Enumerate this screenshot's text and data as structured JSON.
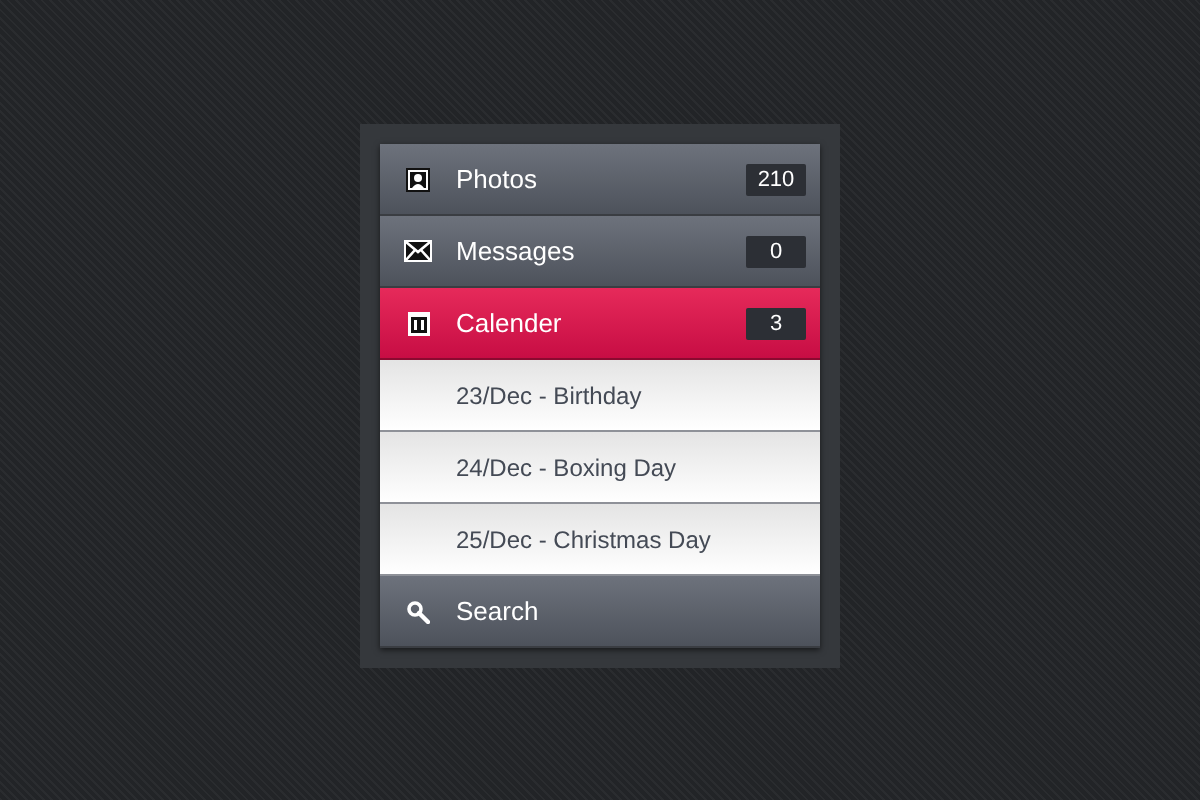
{
  "menu": [
    {
      "kind": "photos",
      "label": "Photos",
      "count": "210",
      "selected": false
    },
    {
      "kind": "messages",
      "label": "Messages",
      "count": "0",
      "selected": false
    },
    {
      "kind": "calendar",
      "label": "Calender",
      "count": "3",
      "selected": true,
      "expanded": true,
      "children": [
        {
          "label": "23/Dec - Birthday"
        },
        {
          "label": "24/Dec - Boxing Day"
        },
        {
          "label": "25/Dec - Christmas Day"
        }
      ]
    },
    {
      "kind": "search",
      "label": "Search",
      "selected": false
    }
  ]
}
